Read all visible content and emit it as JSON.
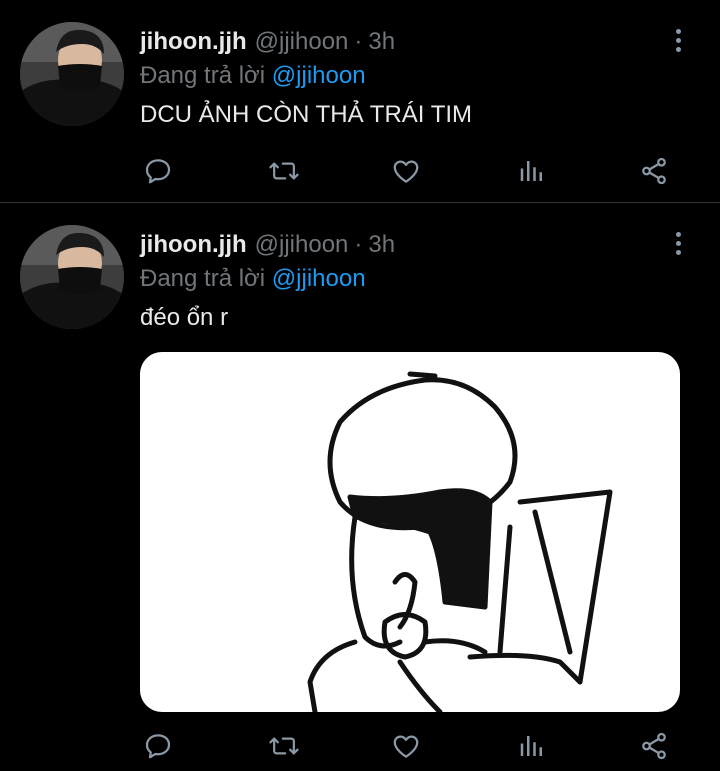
{
  "tweets": [
    {
      "author_name": "jihoon.jjh",
      "handle": "@jjihoon",
      "separator": "·",
      "time": "3h",
      "reply_prefix": "Đang trả lời",
      "reply_to": "@jjihoon",
      "text": "DCU ẢNH CÒN THẢ TRÁI TIM",
      "has_media": false
    },
    {
      "author_name": "jihoon.jjh",
      "handle": "@jjihoon",
      "separator": "·",
      "time": "3h",
      "reply_prefix": "Đang trả lời",
      "reply_to": "@jjihoon",
      "text": "đéo ổn r",
      "has_media": true
    }
  ],
  "icons": {
    "reply": "reply-icon",
    "retweet": "retweet-icon",
    "like": "heart-icon",
    "stats": "stats-icon",
    "share": "share-icon",
    "more": "more-vertical-icon"
  },
  "colors": {
    "background": "#000000",
    "text_primary": "#e7e9ea",
    "text_secondary": "#71767b",
    "link": "#1d9bf0",
    "icon": "#8b98a5",
    "divider": "#2f3336"
  }
}
